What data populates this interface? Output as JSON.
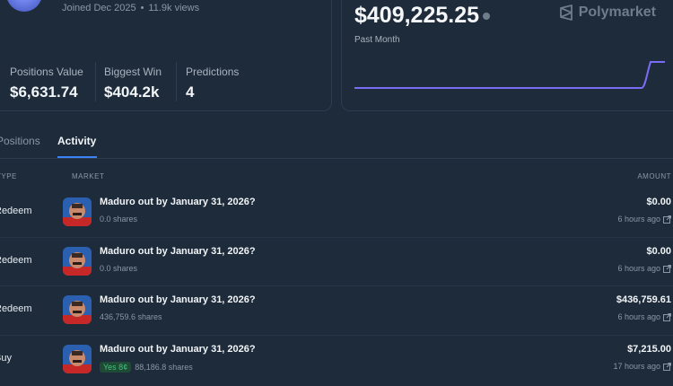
{
  "profile": {
    "joined": "Joined Dec 2025",
    "views": "11.9k views",
    "stats": [
      {
        "label": "Positions Value",
        "value": "$6,631.74"
      },
      {
        "label": "Biggest Win",
        "value": "$404.2k"
      },
      {
        "label": "Predictions",
        "value": "4"
      }
    ]
  },
  "pnl": {
    "value": "$409,225.25",
    "period": "Past Month",
    "brand": "Polymarket",
    "line_color": "#7b6cf6"
  },
  "tabs": [
    {
      "label": "Positions"
    },
    {
      "label": "Activity"
    }
  ],
  "table": {
    "headers": {
      "type": "TYPE",
      "market": "MARKET",
      "amount": "AMOUNT"
    },
    "rows": [
      {
        "type": "Redeem",
        "market": "Maduro out by January 31, 2026?",
        "badge": "",
        "shares": "0.0 shares",
        "amount": "$0.00",
        "time": "6 hours ago"
      },
      {
        "type": "Redeem",
        "market": "Maduro out by January 31, 2026?",
        "badge": "",
        "shares": "0.0 shares",
        "amount": "$0.00",
        "time": "6 hours ago"
      },
      {
        "type": "Redeem",
        "market": "Maduro out by January 31, 2026?",
        "badge": "",
        "shares": "436,759.6 shares",
        "amount": "$436,759.61",
        "time": "6 hours ago"
      },
      {
        "type": "Buy",
        "market": "Maduro out by January 31, 2026?",
        "badge": "Yes 8¢",
        "shares": "88,186.8 shares",
        "amount": "$7,215.00",
        "time": "17 hours ago"
      }
    ]
  },
  "colors": {
    "accent": "#3b82f6",
    "badge_green": "#3fc47a"
  }
}
